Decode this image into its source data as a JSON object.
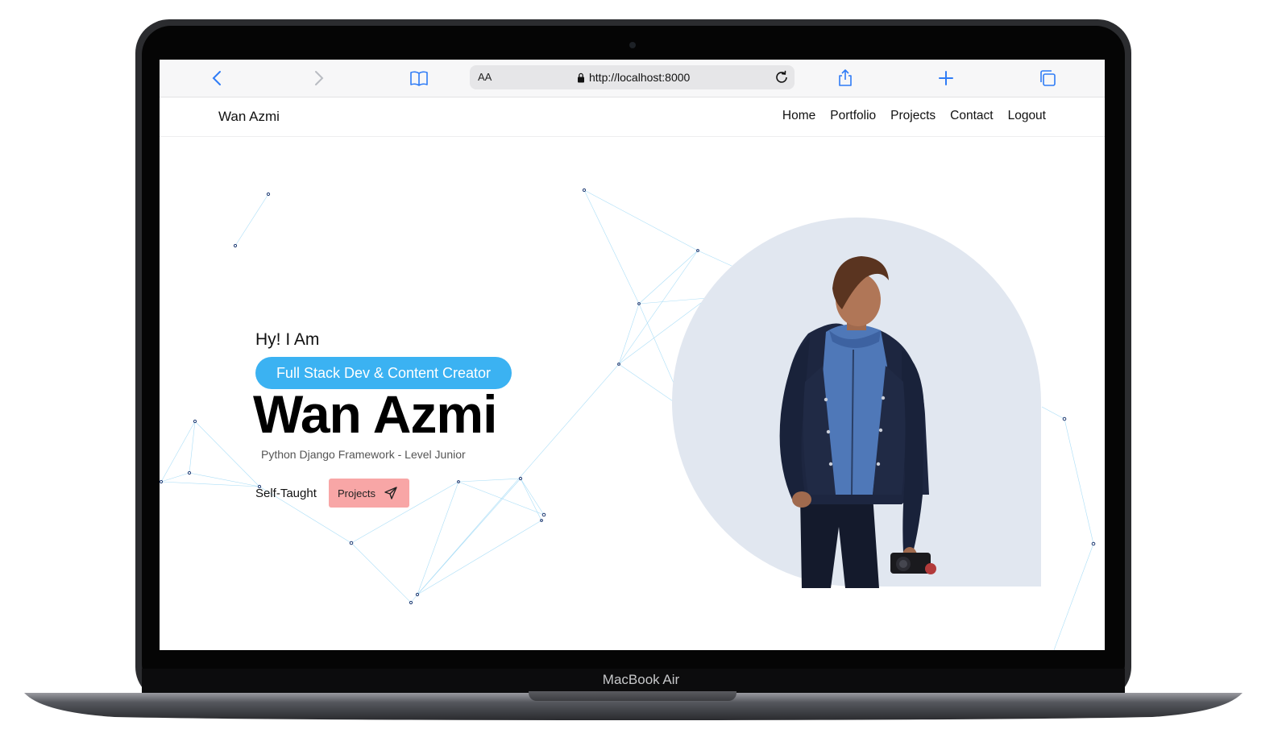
{
  "device": {
    "label": "MacBook Air"
  },
  "browser": {
    "reader_label": "AA",
    "url": "http://localhost:8000",
    "icons": [
      "back-icon",
      "forward-icon",
      "bookmarks-icon",
      "lock-icon",
      "reload-icon",
      "share-icon",
      "new-tab-icon",
      "tabs-icon"
    ]
  },
  "nav": {
    "brand": "Wan Azmi",
    "links": [
      "Home",
      "Portfolio",
      "Projects",
      "Contact",
      "Logout"
    ]
  },
  "hero": {
    "greeting": "Hy! I Am",
    "role_pill": "Full Stack Dev & Content Creator",
    "name": "Wan Azmi",
    "subtitle": "Python Django Framework - Level Junior",
    "tag": "Self-Taught",
    "projects_button": "Projects"
  },
  "colors": {
    "accent_blue": "#3bb2f2",
    "button_pink": "#f8a6a6",
    "arch_bg": "#e1e7f0",
    "ios_blue": "#2f7cf6"
  }
}
